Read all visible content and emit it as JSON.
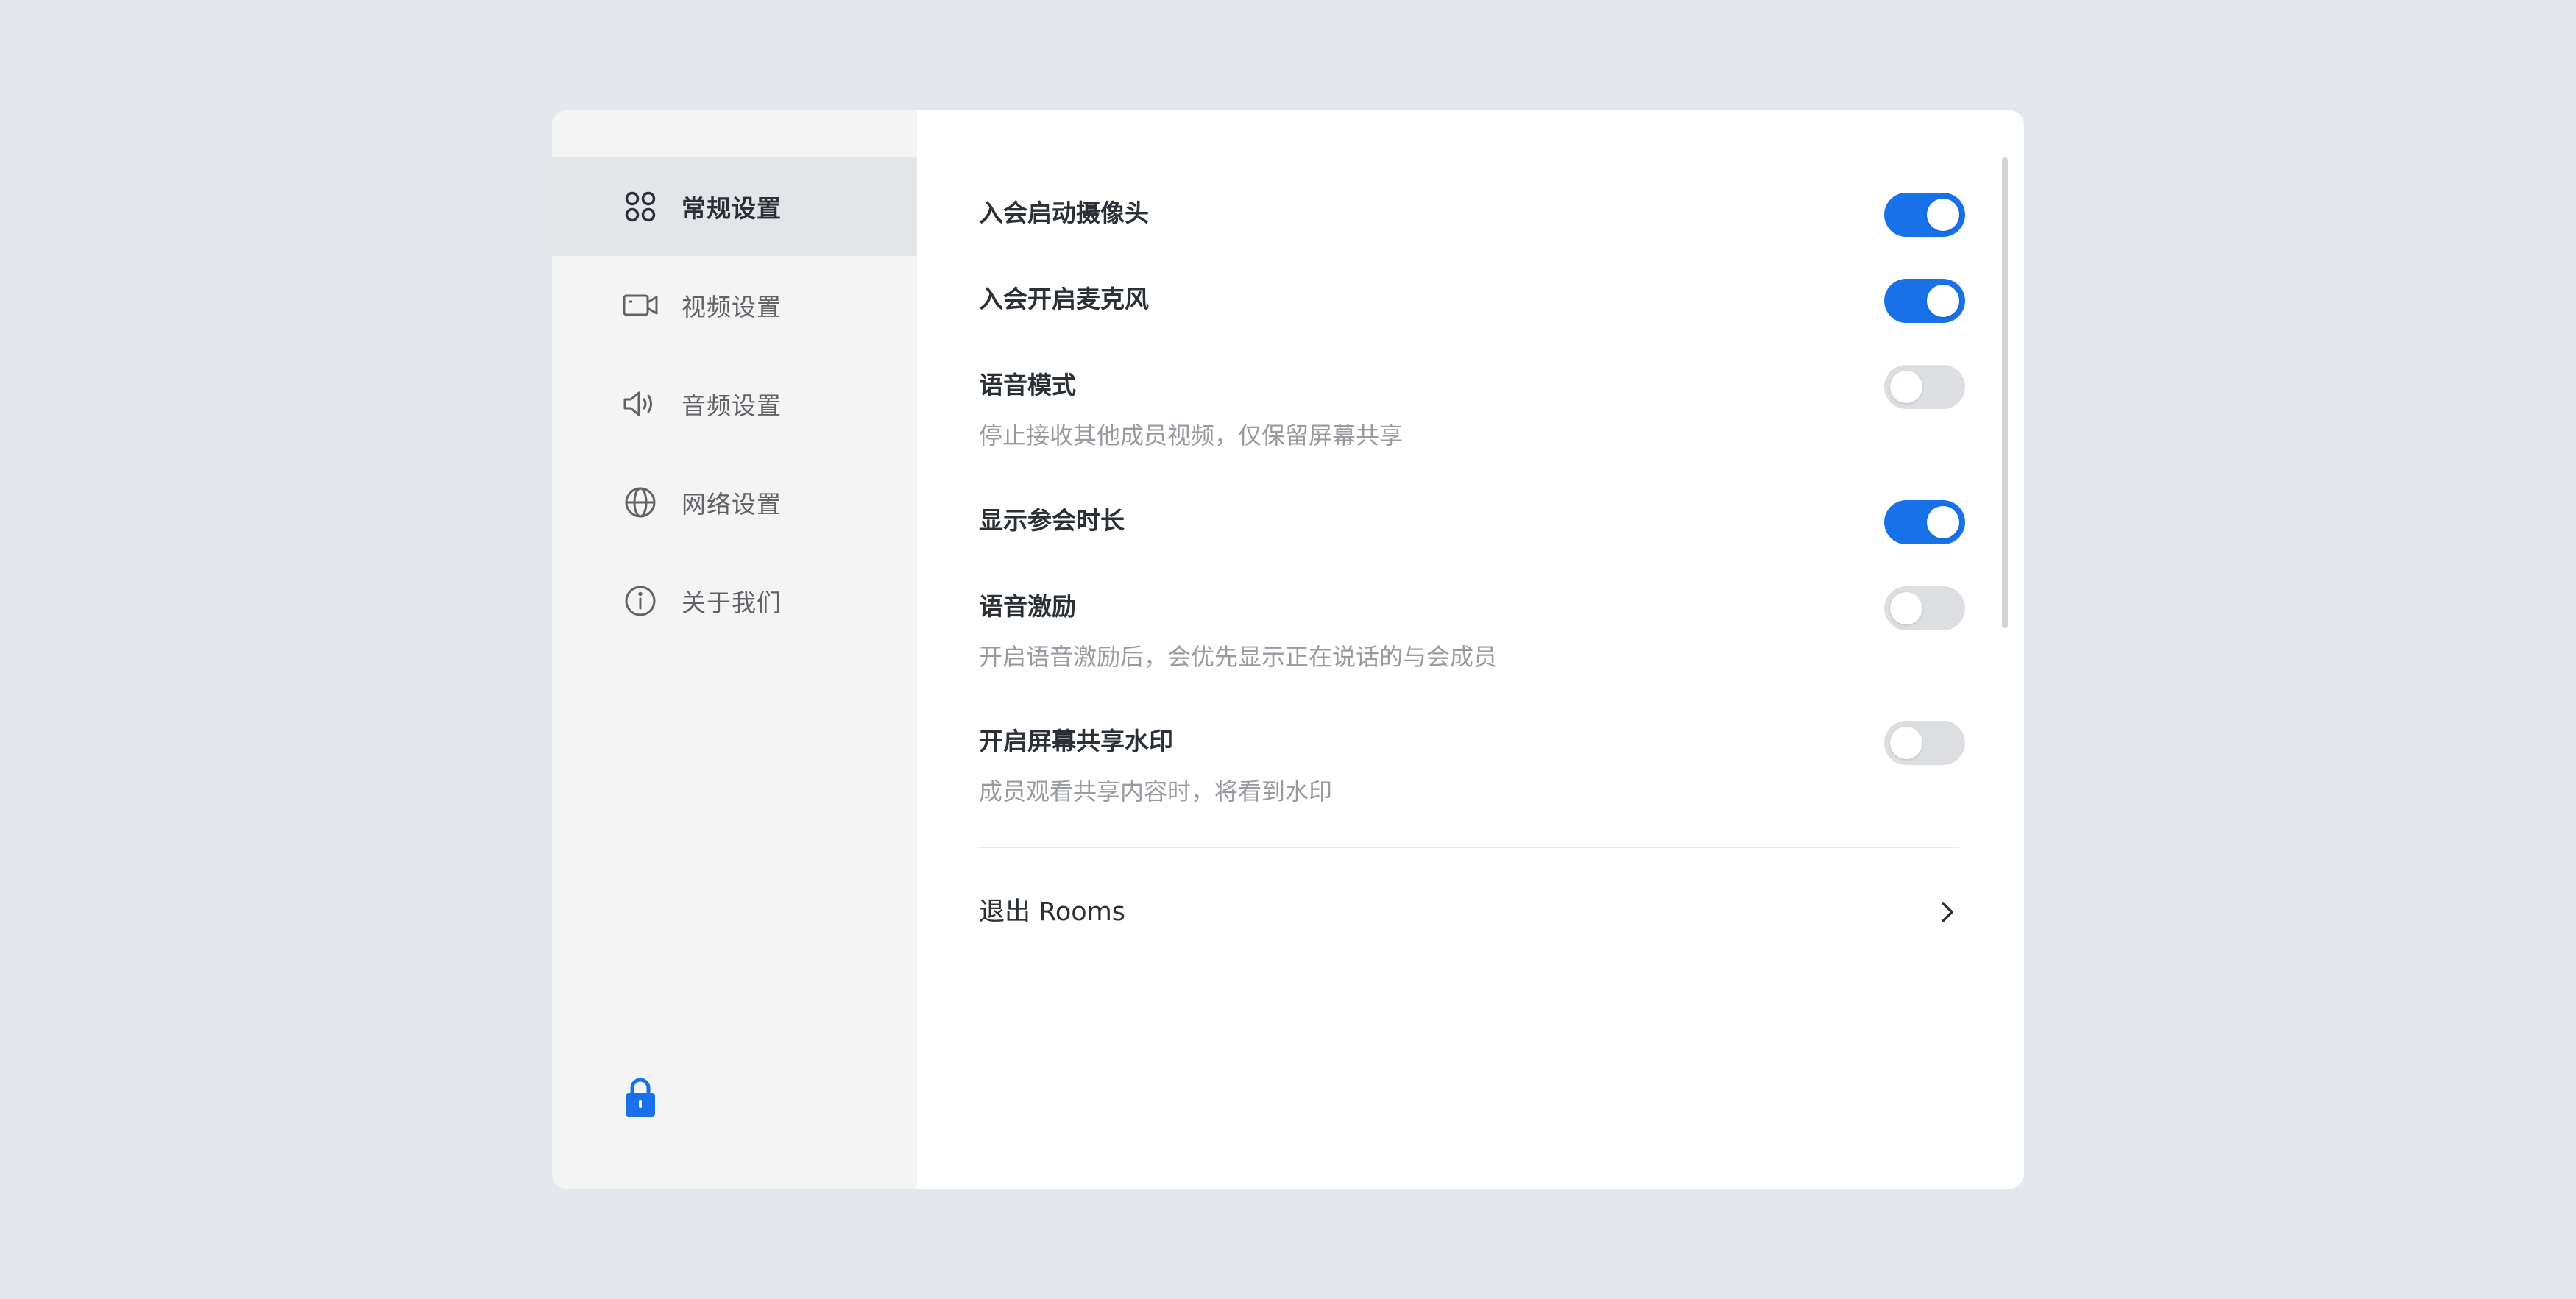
{
  "sidebar": {
    "items": [
      {
        "label": "常规设置",
        "icon": "apps-grid-icon",
        "active": true
      },
      {
        "label": "视频设置",
        "icon": "video-camera-icon",
        "active": false
      },
      {
        "label": "音频设置",
        "icon": "speaker-icon",
        "active": false
      },
      {
        "label": "网络设置",
        "icon": "globe-icon",
        "active": false
      },
      {
        "label": "关于我们",
        "icon": "info-icon",
        "active": false
      }
    ],
    "footer_icon": "lock-icon"
  },
  "settings": [
    {
      "title": "入会启动摄像头",
      "enabled": true
    },
    {
      "title": "入会开启麦克风",
      "enabled": true
    },
    {
      "title": "语音模式",
      "description": "停止接收其他成员视频，仅保留屏幕共享",
      "enabled": false
    },
    {
      "title": "显示参会时长",
      "enabled": true
    },
    {
      "title": "语音激励",
      "description": "开启语音激励后，会优先显示正在说话的与会成员",
      "enabled": false
    },
    {
      "title": "开启屏幕共享水印",
      "description": "成员观看共享内容时，将看到水印",
      "enabled": false
    }
  ],
  "logout": {
    "label": "退出 Rooms",
    "icon": "chevron-right-icon"
  },
  "colors": {
    "accent": "#1871e8",
    "toggle_off": "#dcdee2",
    "background": "#e4e7eb",
    "sidebar": "#f4f4f5",
    "sidebar_active": "#e3e5e8"
  }
}
